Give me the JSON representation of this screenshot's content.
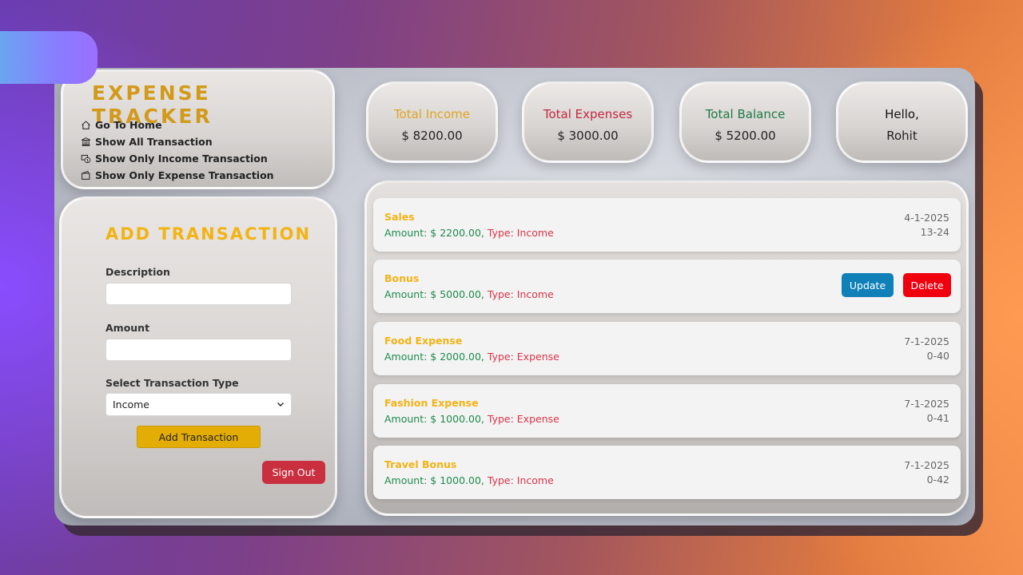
{
  "brand": {
    "title": "EXPENSE TRACKER"
  },
  "nav": [
    {
      "label": "Go To Home",
      "icon": "home-icon"
    },
    {
      "label": "Show All Transaction",
      "icon": "bank-icon"
    },
    {
      "label": "Show Only Income Transaction",
      "icon": "money-icon"
    },
    {
      "label": "Show Only Expense Transaction",
      "icon": "wallet-icon"
    }
  ],
  "form": {
    "title": "ADD TRANSACTION",
    "description_label": "Description",
    "description_value": "",
    "amount_label": "Amount",
    "amount_value": "",
    "type_label": "Select Transaction Type",
    "type_selected": "Income",
    "add_button": "Add Transaction",
    "signout_button": "Sign Out"
  },
  "stats": {
    "income_label": "Total Income",
    "income_value": "$ 8200.00",
    "expenses_label": "Total Expenses",
    "expenses_value": "$ 3000.00",
    "balance_label": "Total Balance",
    "balance_value": "$ 5200.00",
    "greeting": "Hello,",
    "user": "Rohit"
  },
  "transactions": [
    {
      "name": "Sales",
      "amount": "Amount: $ 2200.00,",
      "type": "Type: Income",
      "date": "4-1-2025",
      "time": "13-24"
    },
    {
      "name": "Bonus",
      "amount": "Amount: $ 5000.00,",
      "type": "Type: Income",
      "update": "Update",
      "delete": "Delete"
    },
    {
      "name": "Food Expense",
      "amount": "Amount: $ 2000.00,",
      "type": "Type: Expense",
      "date": "7-1-2025",
      "time": "0-40"
    },
    {
      "name": "Fashion Expense",
      "amount": "Amount: $ 1000.00,",
      "type": "Type: Expense",
      "date": "7-1-2025",
      "time": "0-41"
    },
    {
      "name": "Travel Bonus",
      "amount": "Amount: $ 1000.00,",
      "type": "Type: Income",
      "date": "7-1-2025",
      "time": "0-42"
    }
  ],
  "colors": {
    "brand": "#d39a1a",
    "accent_yellow": "#f2b314",
    "income": "#1f8a4c",
    "expense_red": "#d9344a",
    "update_btn": "#1080b8",
    "delete_btn": "#f0000f"
  }
}
